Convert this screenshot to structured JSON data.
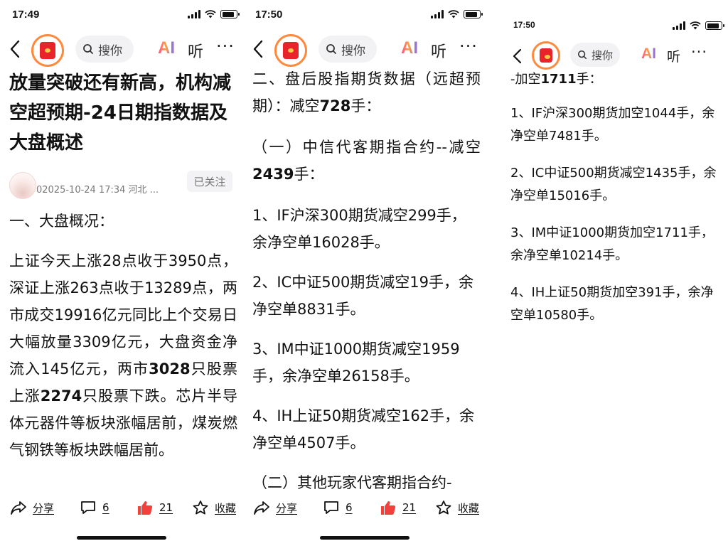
{
  "panels": [
    {
      "status": {
        "time": "17:49"
      },
      "nav": {
        "search_placeholder": "搜你",
        "ai": "AI",
        "listen": "听",
        "more": "···"
      },
      "article": {
        "title": "放量突破还有新高，机构减空超预期-24日期指数据及大盘概述",
        "author_meta": "02025-10-24 17:34 河北 ...",
        "follow_label": "已关注",
        "section_heading": "一、大盘概况：",
        "para_1": "上证今天上涨28点收于3950点，深证上涨263点收于13289点，两市成交19916亿元同比上个交易日大幅放量3309亿元，大盘资金净流入145亿元，两市",
        "bold_1": "3028",
        "para_2": "只股票上涨",
        "bold_2": "2274",
        "para_3": "只股票下跌。芯片半导体元器件等板块涨幅居前，煤炭燃气钢铁等板块跌幅居前。"
      },
      "bottom": {
        "share": "分享",
        "comments": "6",
        "likes": "21",
        "favorite": "收藏"
      }
    },
    {
      "status": {
        "time": "17:50"
      },
      "nav": {
        "search_placeholder": "搜你",
        "ai": "AI",
        "listen": "听",
        "more": "···"
      },
      "article": {
        "heading_1_text": "二、盘后股指期货数据（远超预期）：减空",
        "heading_1_bold": "728",
        "heading_1_tail": "手：",
        "sub_1_text": "（一）中信代客期指合约--减空",
        "sub_1_bold": "2439",
        "sub_1_tail": "手：",
        "items": [
          "1、IF沪深300期货减空299手，余净空单16028手。",
          "2、IC中证500期货减空19手，余净空单8831手。",
          "3、IM中证1000期货减空1959手，余净空单26158手。",
          "4、IH上证50期货减空162手，余净空单4507手。"
        ],
        "sub_2": "（二）其他玩家代客期指合约-"
      },
      "bottom": {
        "share": "分享",
        "comments": "6",
        "likes": "21",
        "favorite": "收藏"
      }
    },
    {
      "status": {
        "time": "17:50"
      },
      "nav": {
        "search_placeholder": "搜你",
        "ai": "AI",
        "listen": "听",
        "more": "···"
      },
      "article": {
        "lead_text": "-加空",
        "lead_bold": "1711",
        "lead_tail": "手：",
        "items": [
          "1、IF沪深300期货加空1044手，余净空单7481手。",
          "2、IC中证500期货减空1435手，余净空单15016手。",
          "3、IM中证1000期货加空1711手，余净空单10214手。",
          "4、IH上证50期货加空391手，余净空单10580手。"
        ]
      }
    }
  ]
}
